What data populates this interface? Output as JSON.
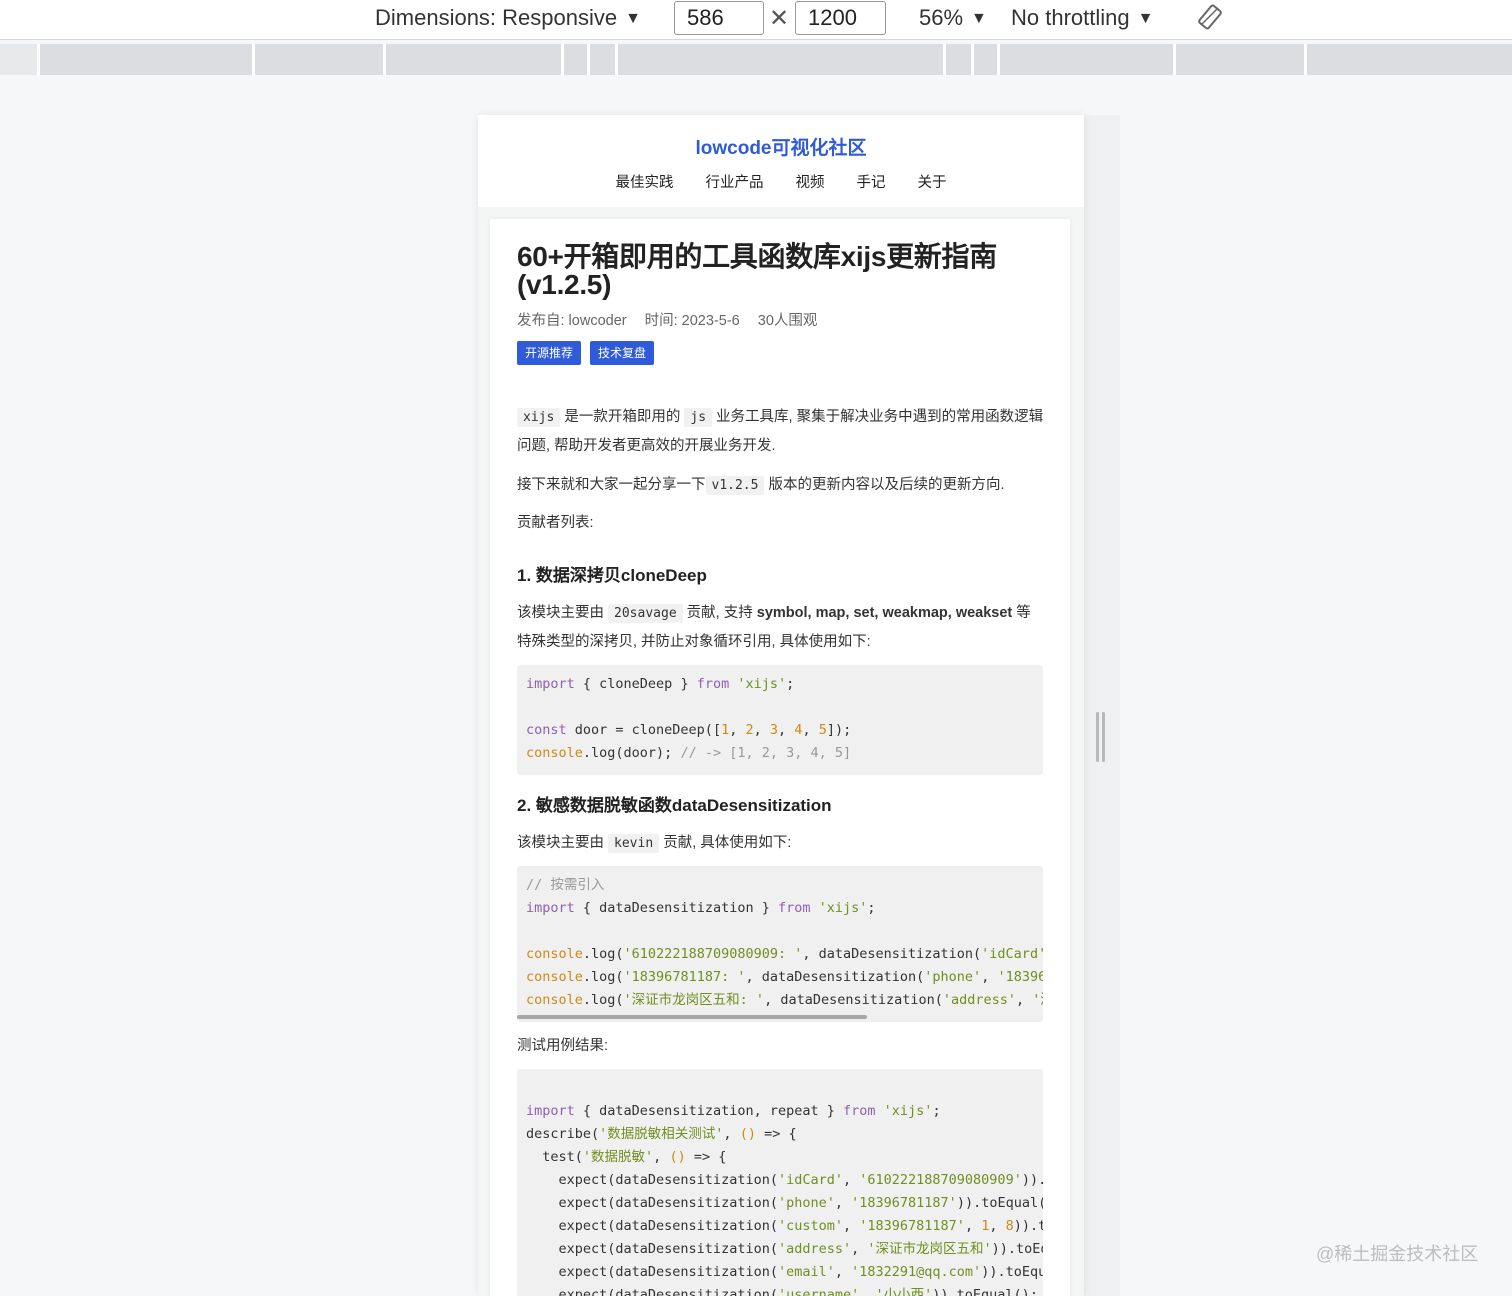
{
  "toolbar": {
    "dimensions_label": "Dimensions: Responsive",
    "width_value": "586",
    "times": "✕",
    "height_value": "1200",
    "zoom_label": "56%",
    "throttling_label": "No throttling",
    "arrow": "▼"
  },
  "site": {
    "title": "lowcode可视化社区",
    "nav": [
      "最佳实践",
      "行业产品",
      "视频",
      "手记",
      "关于"
    ]
  },
  "article": {
    "title": "60+开箱即用的工具函数库xijs更新指南(v1.2.5)",
    "author": "发布自: lowcoder",
    "date": "时间: 2023-5-6",
    "views": "30人围观",
    "tags": [
      "开源推荐",
      "技术复盘"
    ],
    "intro_code1": "xijs",
    "intro_text1": " 是一款开箱即用的 ",
    "intro_code2": "js",
    "intro_text2": " 业务工具库, 聚集于解决业务中遇到的常用函数逻辑问题, 帮助开发者更高效的开展业务开发.",
    "share_text1": "接下来就和大家一起分享一下",
    "share_code": "v1.2.5",
    "share_text2": " 版本的更新内容以及后续的更新方向.",
    "contributors": "贡献者列表:",
    "h1": "1. 数据深拷贝cloneDeep",
    "p1_text1": "该模块主要由 ",
    "p1_code": "20savage",
    "p1_text2": " 贡献, 支持 ",
    "p1_bold": "symbol, map, set, weakmap, weakset",
    "p1_text3": " 等特殊类型的深拷贝, 并防止对象循环引用, 具体使用如下:",
    "h2": "2. 敏感数据脱敏函数dataDesensitization",
    "p2_text1": "该模块主要由 ",
    "p2_code": "kevin",
    "p2_text2": " 贡献, 具体使用如下:",
    "test_label": "测试用例结果:"
  },
  "watermark": "@稀土掘金技术社区"
}
